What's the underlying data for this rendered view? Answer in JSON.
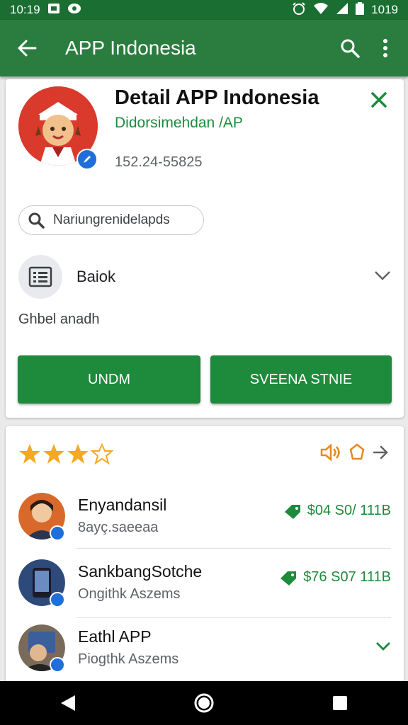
{
  "status_bar": {
    "time": "10:19",
    "right_text": "1019"
  },
  "app_bar": {
    "title": "APP Indonesia"
  },
  "detail": {
    "title": "Detail APP Indonesia",
    "developer": "Didorsimehdan /AP",
    "id_number": "152.24-55825",
    "search_pill": "Nariungrenidelapds",
    "category_label": "Baiok",
    "subtext": "Ghbel anadh",
    "button_left": "UNDM",
    "button_right": "SVEENA STNIE"
  },
  "rating": {
    "value": 3,
    "max": 4
  },
  "list": [
    {
      "name": "Enyandansil",
      "sub": "8ayç.saeeaa",
      "price": "$04 S0/ 111B",
      "trailing": "price"
    },
    {
      "name": "SankbangSotche",
      "sub": "Ongithk Aszems",
      "price": "$76 S07 111B",
      "trailing": "price"
    },
    {
      "name": "Eathl APP",
      "sub": "Piogthk Aszems",
      "price": "",
      "trailing": "chevron"
    }
  ],
  "colors": {
    "primary_dark": "#1b6e32",
    "primary": "#2a7d3f",
    "button": "#1e8a3c",
    "star": "#f4a825",
    "accent_orange": "#e8871e"
  },
  "icons": {
    "back": "arrow-left-icon",
    "search": "search-icon",
    "more": "more-vert-icon",
    "close": "close-icon",
    "list": "list-icon",
    "chevron": "chevron-down-icon",
    "tag": "tag-icon"
  }
}
